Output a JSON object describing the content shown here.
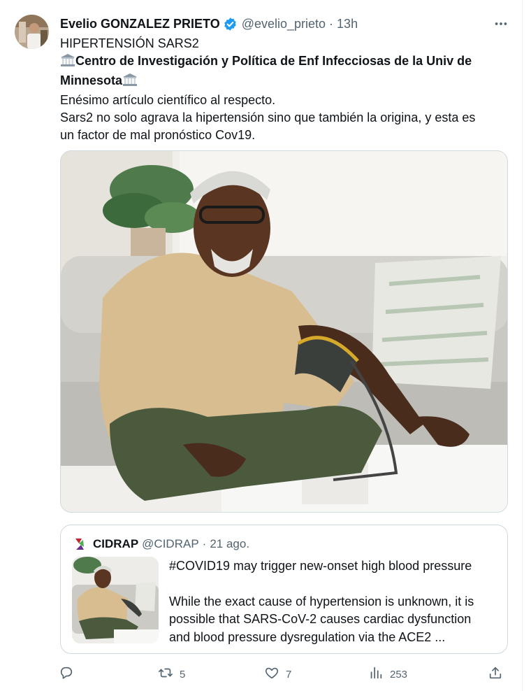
{
  "tweet": {
    "display_name": "Evelio GONZALEZ PRIETO",
    "handle": "@evelio_prieto",
    "separator": "·",
    "time": "13h",
    "line1": "HIPERTENSIÓN SARS2",
    "bold_part1": "Centro de Investigación y Política de Enf Infecciosas de la Univ de",
    "bold_part2": "Minnesota",
    "line3": "Enésimo artículo científico al respecto.",
    "line4": "Sars2 no solo agrava la hipertensión sino que también la origina, y esta es",
    "line5": "un factor de mal pronóstico Cov19."
  },
  "quote": {
    "name": "CIDRAP",
    "handle": "@CIDRAP",
    "separator": "·",
    "time": "21 ago.",
    "headline": "#COVID19 may trigger new-onset high blood pressure",
    "body_line1": "While the exact cause of hypertension is unknown, it is",
    "body_line2": "possible that SARS-CoV-2 causes cardiac dysfunction",
    "body_line3": "and blood pressure dysregulation via the ACE2 ..."
  },
  "actions": {
    "reply_count": "",
    "retweet_count": "5",
    "like_count": "7",
    "views_count": "253"
  },
  "icons": {
    "verified": "verified-badge-icon",
    "more": "more-icon",
    "bank": "classical-building-icon",
    "reply": "reply-icon",
    "retweet": "retweet-icon",
    "like": "heart-icon",
    "views": "views-chart-icon",
    "share": "share-icon"
  },
  "colors": {
    "verified": "#1d9bf0",
    "secondary_text": "#536471",
    "border": "#cfd9de"
  }
}
